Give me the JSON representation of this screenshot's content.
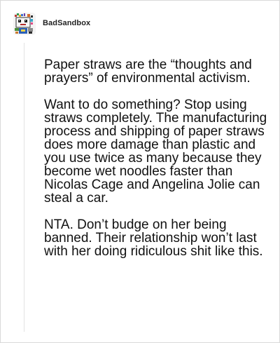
{
  "post": {
    "username": "BadSandbox",
    "paragraphs": [
      "Paper straws are the “thoughts and prayers” of environmental activism.",
      "Want to do something? Stop using straws completely. The manufacturing process and shipping of paper straws does more damage than plastic and you use twice as many because they become wet noodles faster than Nicolas Cage and Angelina Jolie can steal a car.",
      "NTA. Don’t budge on her being banned. Their relationship won’t last with her doing ridiculous shit like this."
    ]
  },
  "icons": {
    "avatar": "pixel-art-avatar"
  },
  "colors": {
    "text": "#111111",
    "username": "#222222",
    "border": "#d9d9d9",
    "rule": "#e2e2e2"
  }
}
